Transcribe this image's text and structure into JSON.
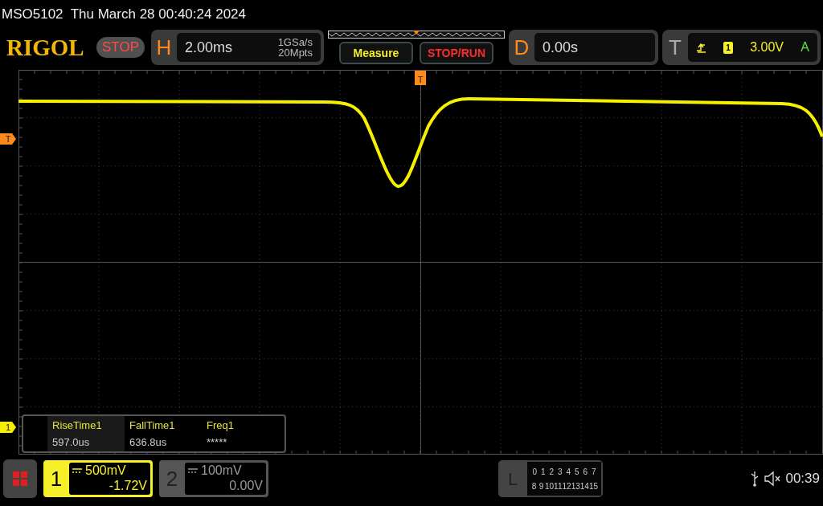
{
  "title_bar": {
    "model": "MSO5102",
    "datetime": "Thu March 28 00:40:24 2024"
  },
  "header": {
    "logo": "RIGOL",
    "run_state": "STOP",
    "horizontal": {
      "label": "H",
      "timebase": "2.00ms",
      "sample_rate": "1GSa/s",
      "memory_depth": "20Mpts"
    },
    "buttons": [
      "Measure",
      "STOP/RUN"
    ],
    "delay": {
      "label": "D",
      "value": "0.00s"
    },
    "trigger": {
      "label": "T",
      "source": "1",
      "level": "3.00V",
      "mode": "A"
    }
  },
  "markers": {
    "trigger_position": "T",
    "trigger_level": "T",
    "channel_1": "1"
  },
  "measurements": [
    {
      "name": "RiseTime1",
      "value": "597.0us"
    },
    {
      "name": "FallTime1",
      "value": "636.8us"
    },
    {
      "name": "Freq1",
      "value": "*****"
    }
  ],
  "channels": [
    {
      "number": "1",
      "scale": "500mV",
      "offset": "-1.72V",
      "selected": true
    },
    {
      "number": "2",
      "scale": "100mV",
      "offset": "0.00V",
      "selected": false
    }
  ],
  "logic": {
    "label": "L",
    "rows": [
      [
        "0",
        "1",
        "2",
        "3",
        "4",
        "5",
        "6",
        "7"
      ],
      [
        "8",
        "9",
        "10",
        "11",
        "12",
        "13",
        "14",
        "15"
      ]
    ]
  },
  "status": {
    "time": "00:39"
  }
}
